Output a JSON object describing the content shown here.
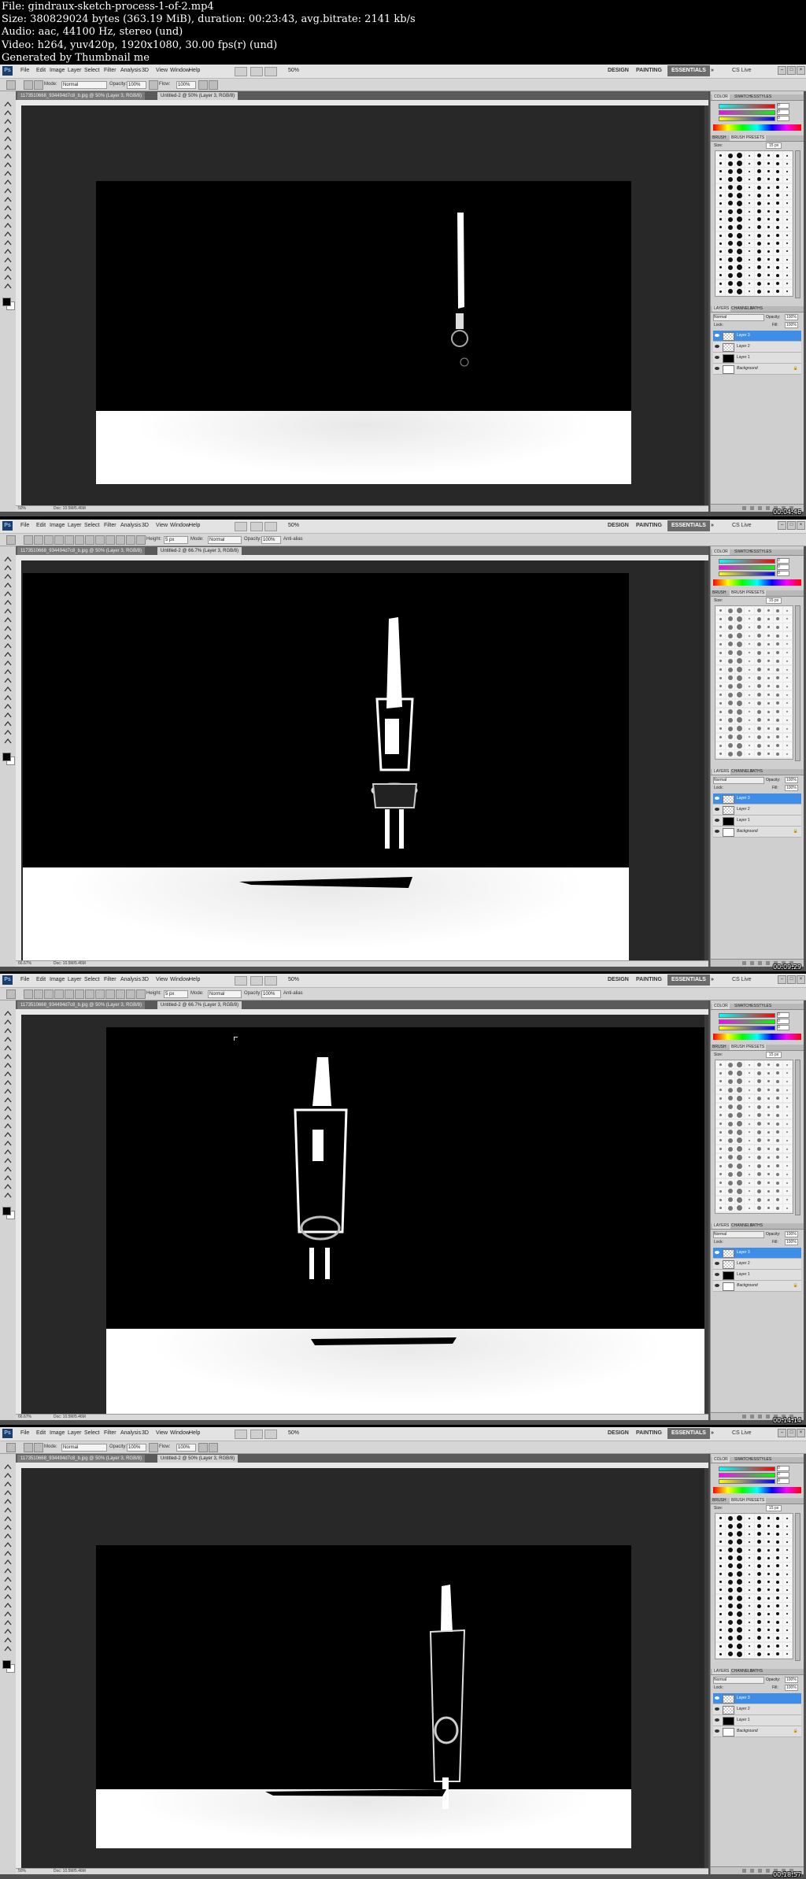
{
  "header": {
    "file": "File: gindraux-sketch-process-1-of-2.mp4",
    "size": "Size: 380829024 bytes (363.19 MiB), duration: 00:23:43, avg.bitrate: 2141 kb/s",
    "audio": "Audio: aac, 44100 Hz, stereo (und)",
    "video": "Video: h264, yuv420p, 1920x1080, 30.00 fps(r) (und)",
    "generated": "Generated by Thumbnail me"
  },
  "app": {
    "logo": "Ps",
    "menu": [
      "File",
      "Edit",
      "Image",
      "Layer",
      "Select",
      "Filter",
      "Analysis",
      "3D",
      "View",
      "Window",
      "Help"
    ],
    "workspaces": [
      "DESIGN",
      "PAINTING",
      "ESSENTIALS"
    ],
    "overflow": "»",
    "cs_live": "CS Live",
    "zoom_control": "50%",
    "accent_color": "#3e8ee8",
    "layers_panel": {
      "tabs": [
        "LAYERS",
        "CHANNELS",
        "PATHS"
      ],
      "blend_mode": "Normal",
      "opacity_label": "Opacity:",
      "opacity_value": "100%",
      "lock_label": "Lock:",
      "fill_label": "Fill:",
      "fill_value": "100%",
      "layers": [
        "Layer 3",
        "Layer 2",
        "Layer 1",
        "Background"
      ]
    },
    "color_panel": {
      "tabs": [
        "COLOR",
        "SWATCHES",
        "STYLES"
      ],
      "values": [
        "0",
        "0",
        "0"
      ]
    },
    "brush_panel": {
      "tabs": [
        "BRUSH",
        "BRUSH PRESETS"
      ],
      "size_label": "Size:",
      "size_value": "15 px"
    }
  },
  "frames": [
    {
      "tool_opts": {
        "mode_label": "Mode:",
        "mode": "Normal",
        "opacity_label": "Opacity:",
        "opacity": "100%",
        "flow_label": "Flow:",
        "flow": "100%"
      },
      "tabs": [
        "1173510668_934494d7c8_b.jpg @ 50% (Layer 3, RGB/8)",
        "Untitled-2 @ 50% (Layer 3, RGB/8)"
      ],
      "status_zoom": "50%",
      "status_doc": "Doc: 10.5M/5.46M",
      "timestamp": "00:04:46"
    },
    {
      "tool_opts": {
        "height_label": "Height:",
        "height": "5 px",
        "mode_label": "Mode:",
        "mode": "Normal",
        "opacity_label": "Opacity:",
        "opacity": "100%",
        "antialias": "Anti-alias"
      },
      "tabs": [
        "1173510668_934494d7c8_b.jpg @ 50% (Layer 3, RGB/8)",
        "Untitled-2 @ 66.7% (Layer 3, RGB/8)"
      ],
      "status_zoom": "66.67%",
      "status_doc": "Doc: 10.5M/5.46M",
      "timestamp": "00:09:29"
    },
    {
      "tool_opts": {
        "height_label": "Height:",
        "height": "5 px",
        "mode_label": "Mode:",
        "mode": "Normal",
        "opacity_label": "Opacity:",
        "opacity": "100%",
        "antialias": "Anti-alias"
      },
      "tabs": [
        "1173510668_934494d7c8_b.jpg @ 50% (Layer 3, RGB/8)",
        "Untitled-2 @ 66.7% (Layer 3, RGB/8)"
      ],
      "status_zoom": "66.67%",
      "status_doc": "Doc: 10.5M/5.46M",
      "timestamp": "00:14:14"
    },
    {
      "tool_opts": {
        "mode_label": "Mode:",
        "mode": "Normal",
        "opacity_label": "Opacity:",
        "opacity": "100%",
        "flow_label": "Flow:",
        "flow": "100%"
      },
      "tabs": [
        "1173510668_934494d7c8_b.jpg @ 50% (Layer 3, RGB/8)",
        "Untitled-2 @ 50% (Layer 3, RGB/8)"
      ],
      "status_zoom": "50%",
      "status_doc": "Doc: 10.5M/5.46M",
      "timestamp": "00:18:57"
    }
  ]
}
